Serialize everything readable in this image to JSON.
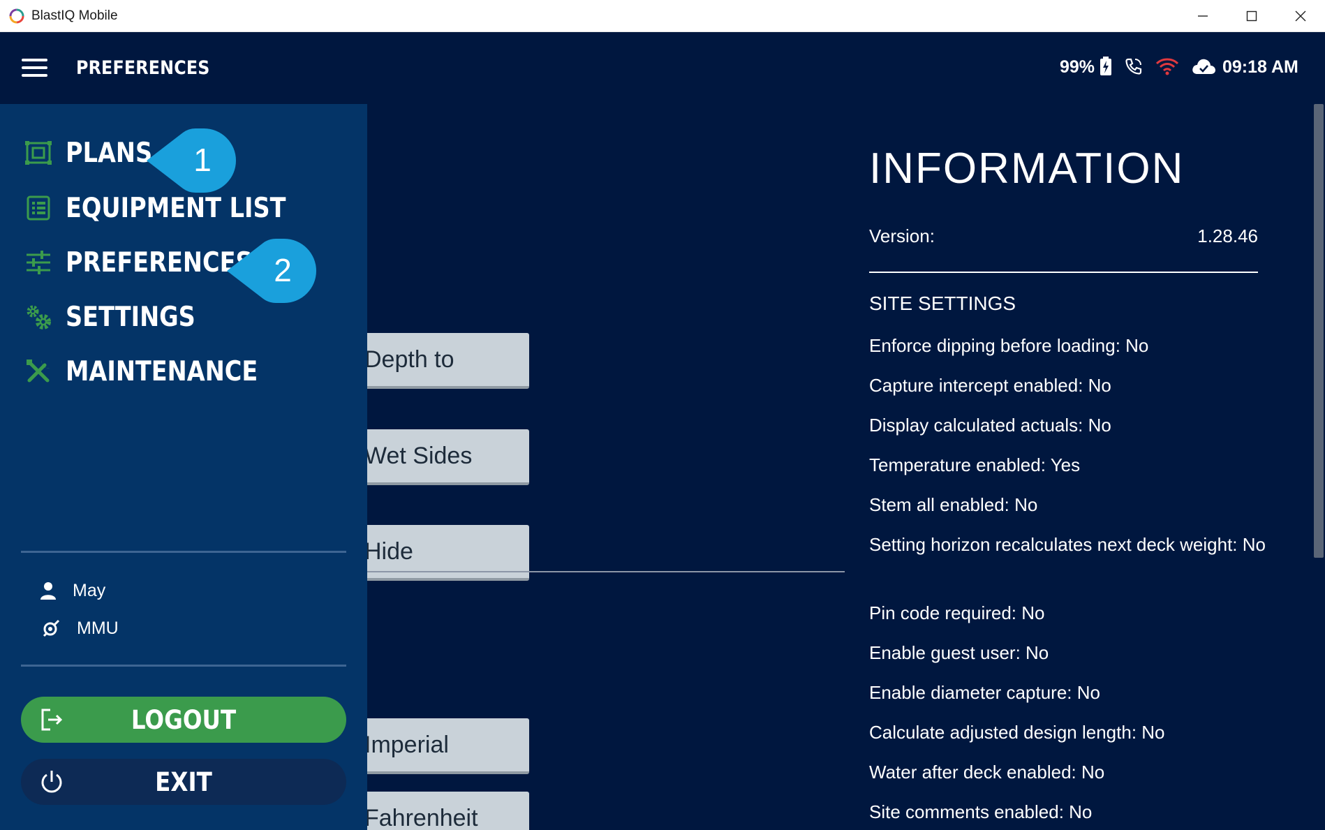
{
  "window": {
    "title": "BlastIQ Mobile"
  },
  "appbar": {
    "title": "PREFERENCES",
    "battery": "99%",
    "time": "09:18 AM",
    "icons": [
      "battery-charging-icon",
      "phone-icon",
      "wifi-icon",
      "cloud-done-icon"
    ],
    "wifi_color": "#e0393e"
  },
  "drawer": {
    "items": [
      {
        "label": "PLANS",
        "icon": "plans-icon",
        "callout": "1"
      },
      {
        "label": "EQUIPMENT LIST",
        "icon": "list-icon"
      },
      {
        "label": "PREFERENCES",
        "icon": "sliders-icon",
        "callout": "2"
      },
      {
        "label": "SETTINGS",
        "icon": "gears-icon"
      },
      {
        "label": "MAINTENANCE",
        "icon": "tools-icon"
      }
    ],
    "user": "May",
    "site": "MMU",
    "logout_label": "LOGOUT",
    "exit_label": "EXIT",
    "icon_color": "#3b9b4c",
    "callout_color": "#1aa0dc"
  },
  "preferences": {
    "buttons": [
      "Depth to",
      "Wet Sides",
      "Hide",
      "Imperial",
      "Fahrenheit"
    ]
  },
  "information": {
    "title": "INFORMATION",
    "version_label": "Version:",
    "version_value": "1.28.46",
    "site_settings_title": "SITE SETTINGS",
    "settings": [
      "Enforce dipping before loading: No",
      "Capture intercept enabled: No",
      "Display calculated actuals: No",
      "Temperature enabled: Yes",
      "Stem all enabled: No",
      "Setting horizon recalculates next deck weight: No",
      "Pin code required: No",
      "Enable guest user: No",
      "Enable diameter capture: No",
      "Calculate adjusted design length: No",
      "Water after deck enabled: No",
      "Site comments enabled: No"
    ]
  }
}
